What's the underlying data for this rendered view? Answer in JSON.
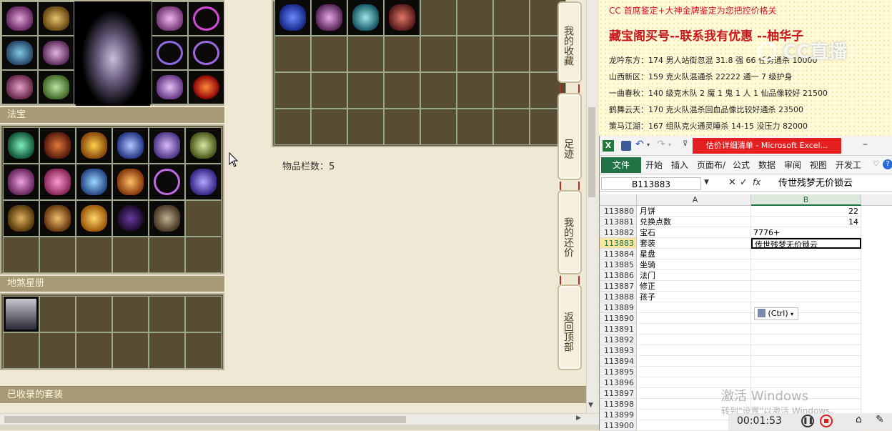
{
  "game": {
    "section_fabao": "法宝",
    "section_dishaxingce": "地煞星册",
    "section_collected_sets": "已收录的套装",
    "item_slot_count": "物品栏数：5",
    "side_buttons": [
      {
        "label": "我的收藏"
      },
      {
        "label": "足迹"
      },
      {
        "label": "我的还价"
      },
      {
        "label": "返回顶部"
      }
    ]
  },
  "ad": {
    "line1": "CC 首席鉴定+大神金牌鉴定为您把控价格关",
    "line2": "藏宝阁买号--联系我有优惠 --柚华子",
    "entries": [
      "龙吟东方：174 男人站街忽混 31.8 强 66 任务通杀 10000",
      "山西新区：159 克火队混通杀 22222 通一 7 级护身",
      "一曲春秋：140 级克木队 2 魔 1 鬼 1 人 1 仙品像较好 21500",
      "鹤舞云天：170 克火队混杀回血品像比较好通杀 23500",
      "策马江湖：167 组队克火通灵睡杀 14-15 没压力 82000"
    ],
    "watermark": "CC直播",
    "colors": {
      "line1": "#d0142b",
      "line2": "#c8161d"
    }
  },
  "excel": {
    "window_title": "估价详细清单 - Microsoft Excel...",
    "minimize": "–",
    "tabs": [
      "文件",
      "开始",
      "插入",
      "页面布/",
      "公式",
      "数据",
      "审阅",
      "视图",
      "开发工"
    ],
    "name_box": "B113883",
    "formula_value": "传世残梦无价锁云",
    "col_a": "A",
    "col_b": "B",
    "rows": [
      {
        "n": "113880",
        "a": "月饼",
        "b": "22"
      },
      {
        "n": "113881",
        "a": "兑换点数",
        "b": "14"
      },
      {
        "n": "113882",
        "a": "宝石",
        "b": "7776+"
      },
      {
        "n": "113883",
        "a": "套装",
        "b": "传世残梦无价锁云"
      },
      {
        "n": "113884",
        "a": "星盘",
        "b": ""
      },
      {
        "n": "113885",
        "a": "坐骑",
        "b": ""
      },
      {
        "n": "113886",
        "a": "法门",
        "b": ""
      },
      {
        "n": "113887",
        "a": "修正",
        "b": ""
      },
      {
        "n": "113888",
        "a": "孩子",
        "b": ""
      },
      {
        "n": "113889",
        "a": "",
        "b": ""
      },
      {
        "n": "113890",
        "a": "",
        "b": ""
      },
      {
        "n": "113891",
        "a": "",
        "b": ""
      },
      {
        "n": "113892",
        "a": "",
        "b": ""
      },
      {
        "n": "113893",
        "a": "",
        "b": ""
      },
      {
        "n": "113894",
        "a": "",
        "b": ""
      },
      {
        "n": "113895",
        "a": "",
        "b": ""
      },
      {
        "n": "113896",
        "a": "",
        "b": ""
      },
      {
        "n": "113897",
        "a": "",
        "b": ""
      },
      {
        "n": "113898",
        "a": "",
        "b": ""
      },
      {
        "n": "113899",
        "a": "",
        "b": ""
      },
      {
        "n": "113900",
        "a": "",
        "b": ""
      }
    ],
    "paste_options": "(Ctrl)",
    "activate_windows": "激活 Windows",
    "activate_hint": "转到\"设置\"以激活 Windows。",
    "timer": "00:01:53"
  }
}
